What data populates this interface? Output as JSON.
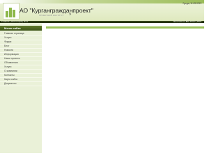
{
  "header": {
    "title": "АО \"Кургангражданпроект\"",
    "subtitle": "ПРОЕКТНЫЙ ИНСТИТУТ",
    "date": "Среда, 11.09.2013",
    "logo_icon": "building-logo-icon",
    "arrows_icon": "double-chevron-right-icon"
  },
  "nav": {
    "crumb": "Главная | Настоящий | Блог",
    "right": "Политика на Вас Ромм | RSS"
  },
  "sidebar": {
    "title": "Меню сайта",
    "items": [
      {
        "label": "Главная страница"
      },
      {
        "label": "Услуги"
      },
      {
        "label": "Форум"
      },
      {
        "label": "Блог"
      },
      {
        "label": "Новости"
      },
      {
        "label": "Информация"
      },
      {
        "label": "Наши проекты"
      },
      {
        "label": "Объявления"
      },
      {
        "label": "Услуги"
      },
      {
        "label": "О компании"
      },
      {
        "label": "Контакты"
      },
      {
        "label": "Карта сайта"
      },
      {
        "label": "Документы"
      }
    ]
  },
  "colors": {
    "accent": "#9cc25a",
    "nav_bg": "#2a3812",
    "sidebar_bg": "#eaf1d8"
  }
}
